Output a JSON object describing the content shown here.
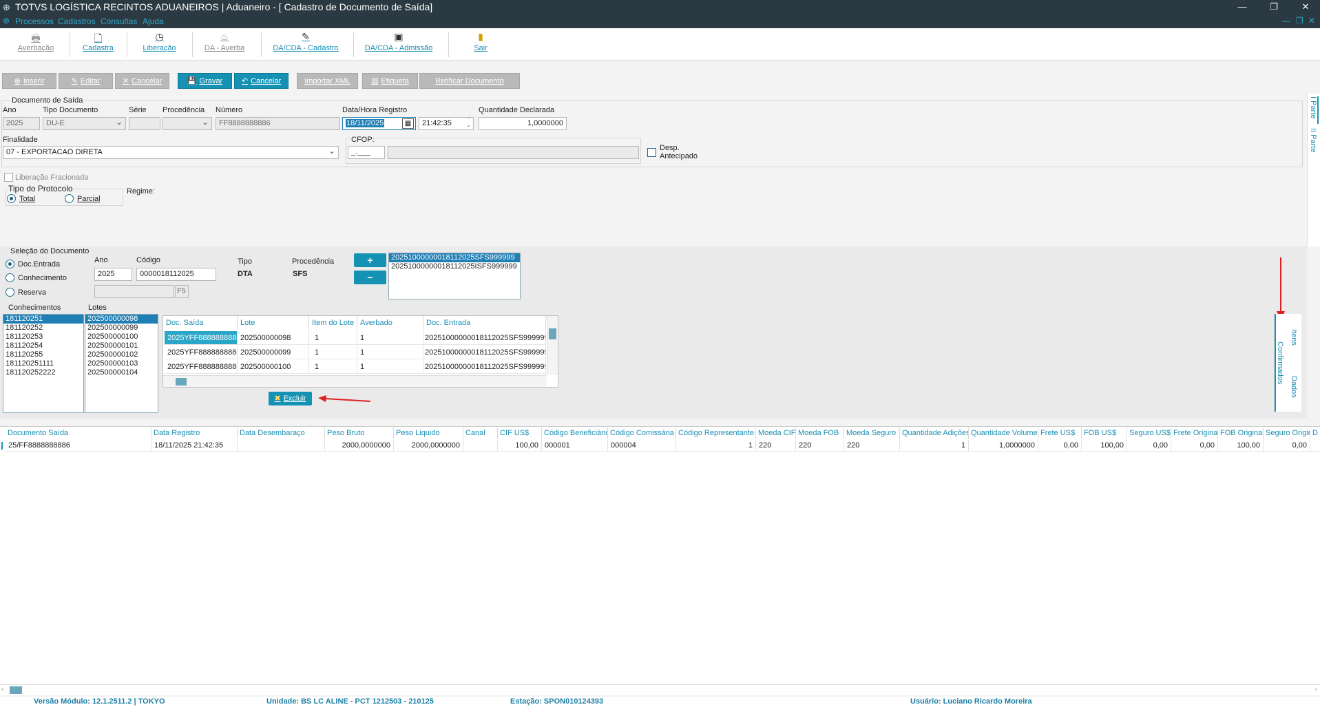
{
  "window": {
    "title": "TOTVS LOGÍSTICA RECINTOS ADUANEIROS | Aduaneiro - [ Cadastro de Documento de Saída]"
  },
  "menu": [
    "Processos",
    "Cadastros",
    "Consultas",
    "Ajuda"
  ],
  "toolbar": [
    {
      "label": "Averbação",
      "icon": "printer-icon",
      "enabled": false
    },
    {
      "label": "Cadastra",
      "icon": "document-icon",
      "enabled": true
    },
    {
      "label": "Liberação",
      "icon": "clock-icon",
      "enabled": true
    },
    {
      "label": "DA - Averba",
      "icon": "stamp-icon",
      "enabled": false
    },
    {
      "label": "DA/CDA - Cadastro",
      "icon": "document-edit-icon",
      "enabled": true
    },
    {
      "label": "DA/CDA - Admissão",
      "icon": "admission-icon",
      "enabled": true
    },
    {
      "label": "Sair",
      "icon": "exit-door-icon",
      "enabled": true
    }
  ],
  "actions": {
    "inserir": "Inserir",
    "editar": "Editar",
    "cancelar1": "Cancelar",
    "gravar": "Gravar",
    "cancelar2": "Cancelar",
    "importar_xml": "Importar XML",
    "etiqueta": "Etiqueta",
    "retificar": "Retificar Documento"
  },
  "doc": {
    "section": "Documento de Saída",
    "ano_label": "Ano",
    "ano": "2025",
    "tipo_label": "Tipo Documento",
    "tipo": "DU-E",
    "serie_label": "Série",
    "serie": "",
    "proc_label": "Procedência",
    "proc": "",
    "numero_label": "Número",
    "numero": "FF8888888886",
    "datahora_label": "Data/Hora Registro",
    "data": "18/11/2025",
    "hora": "21:42:35",
    "qtd_label": "Quantidade Declarada",
    "qtd": "1,0000000",
    "finalidade_label": "Finalidade",
    "finalidade": "07 - EXPORTACAO DIRETA",
    "cfop_label": "CFOP:",
    "cfop": "_.___",
    "cfop_desc": "",
    "desp_label1": "Desp.",
    "desp_label2": "Antecipado",
    "lib_frac": "Liberação Fracionada",
    "protocolo_label": "Tipo do Protocolo",
    "total": "Total",
    "parcial": "Parcial",
    "regime_label": "Regime:"
  },
  "side_tabs": {
    "parte1": "I Parte",
    "parte2": "II Parte"
  },
  "selecao": {
    "title": "Seleção do Documento",
    "opts": [
      "Doc.Entrada",
      "Conhecimento",
      "Reserva"
    ],
    "ano_label": "Ano",
    "ano": "2025",
    "codigo_label": "Código",
    "codigo": "0000018112025",
    "tipo_label": "Tipo",
    "tipo": "DTA",
    "proc_label": "Procedência",
    "proc": "SFS",
    "f5": "F5",
    "docs": [
      "20251000000018112025SFS999999",
      "20251000000018112025ISFS999999"
    ]
  },
  "conhecimentos": {
    "label": "Conhecimentos",
    "items": [
      "181120251",
      "181120252",
      "181120253",
      "181120254",
      "181120255",
      "181120251111",
      "181120252222"
    ]
  },
  "lotes": {
    "label": "Lotes",
    "items": [
      "202500000098",
      "202500000099",
      "202500000100",
      "202500000101",
      "202500000102",
      "202500000103",
      "202500000104"
    ]
  },
  "inner_grid": {
    "headers": [
      "Doc. Saída",
      "Lote",
      "Item do Lote",
      "Averbado",
      "Doc. Entrada"
    ],
    "rows": [
      [
        "2025YFF8888888886",
        "202500000098",
        "1",
        "1",
        "20251000000018112025SFS999999"
      ],
      [
        "2025YFF8888888886",
        "202500000099",
        "1",
        "1",
        "20251000000018112025SFS999999"
      ],
      [
        "2025YFF8888888886",
        "202500000100",
        "1",
        "1",
        "20251000000018112025SFS999999"
      ]
    ]
  },
  "excluir": "Excluir",
  "vtabs": {
    "itens": "Itens",
    "dados": "Dados",
    "confirmados": "Confirmados"
  },
  "main_grid": {
    "headers": [
      "Documento Saída",
      "Data Registro",
      "Data  Desembaraço",
      "Peso Bruto",
      "Peso Liquido",
      "Canal",
      "CIF US$",
      "Código Beneficiário",
      "Código Comissária",
      "Código Representante",
      "Moeda CIF",
      "Moeda FOB",
      "Moeda Seguro",
      "Quantidade Adições",
      "Quantidade Volumes",
      "Frete US$",
      "FOB US$",
      "Seguro US$",
      "Frete Original",
      "FOB Original",
      "Seguro Original",
      "D"
    ],
    "row": [
      "25/FF8888888886",
      "18/11/2025 21:42:35",
      "",
      "2000,0000000",
      "2000,0000000",
      "",
      "100,00",
      "000001",
      "000004",
      "1",
      "220",
      "220",
      "220",
      "1",
      "1,0000000",
      "0,00",
      "100,00",
      "0,00",
      "0,00",
      "100,00",
      "0,00",
      ""
    ]
  },
  "status": {
    "versao": "Versão Módulo:  12.1.2511.2  |  TOKYO",
    "unidade": "Unidade: BS LC ALINE - PCT 1212503 - 210125",
    "estacao": "Estação: SPON010124393",
    "usuario": "Usuário: Luciano Ricardo Moreira"
  },
  "colors": {
    "accent": "#1592b3",
    "titlebar": "#2b3a42",
    "link": "#1a8fb5",
    "annotation": "#e02020"
  }
}
